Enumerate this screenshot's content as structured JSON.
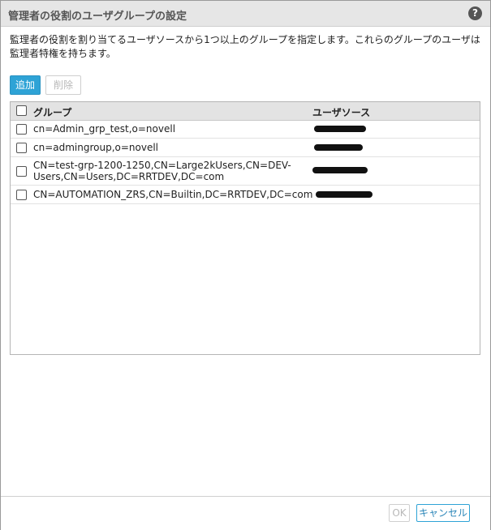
{
  "dialog": {
    "title": "管理者の役割のユーザグループの設定",
    "help_icon": "?",
    "description": "監理者の役割を割り当てるユーザソースから1つ以上のグループを指定します。これらのグループのユーザは監理者特権を持ちます。"
  },
  "toolbar": {
    "add_label": "追加",
    "delete_label": "削除"
  },
  "grid": {
    "columns": [
      "グループ",
      "ユーザソース"
    ],
    "rows": [
      {
        "group": "cn=Admin_grp_test,o=novell",
        "source_redacted": true
      },
      {
        "group": "cn=admingroup,o=novell",
        "source_redacted": true
      },
      {
        "group": "CN=test-grp-1200-1250,CN=Large2kUsers,CN=DEV-Users,CN=Users,DC=RRTDEV,DC=com",
        "source_redacted": true
      },
      {
        "group": "CN=AUTOMATION_ZRS,CN=Builtin,DC=RRTDEV,DC=com",
        "source_redacted": true
      }
    ]
  },
  "footer": {
    "ok_label": "OK",
    "cancel_label": "キャンセル"
  },
  "colors": {
    "accent": "#2ea3d6",
    "header_bg": "#e3e3e3",
    "titlebar_bg": "#e6e6e6"
  }
}
